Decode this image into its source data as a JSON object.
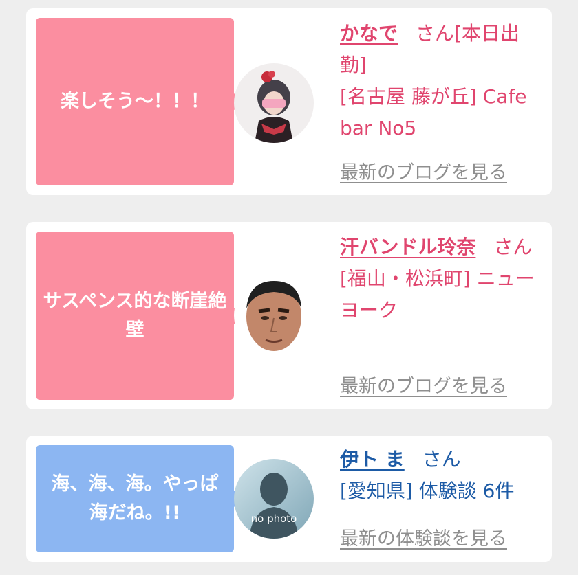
{
  "entries": [
    {
      "bubble_text": "楽しそう～！！！",
      "name": "かなで",
      "suffix": "さん[本日出勤]",
      "location": "[名古屋 藤が丘] Cafe bar No5",
      "link": "最新のブログを見る",
      "bubble_color": "#fb8ea0",
      "text_color": "#e0456e"
    },
    {
      "bubble_text": "サスペンス的な断崖絶壁",
      "name": "汗バンドル玲奈",
      "suffix": "さん",
      "location": "[福山・松浜町] ニューヨーク",
      "link": "最新のブログを見る",
      "bubble_color": "#fb8ea0",
      "text_color": "#e0456e"
    },
    {
      "bubble_text": "海、海、海。やっぱ海だね。!!",
      "name": "伊ト ま",
      "suffix": "さん",
      "location": "[愛知県] 体験談 6件",
      "link": "最新の体験談を見る",
      "avatar_caption": "no photo",
      "bubble_color": "#8cb6f2",
      "text_color": "#1d5ba6"
    }
  ]
}
